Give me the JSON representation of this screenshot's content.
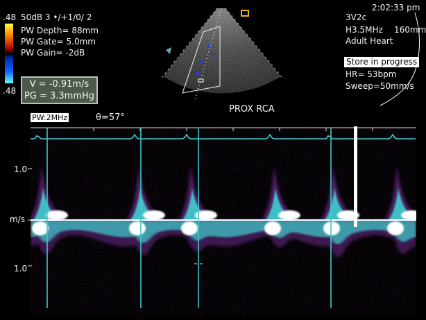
{
  "header": {
    "time": "2:02:33 pm",
    "probe": "3V2c",
    "frequency": "H3.5MHz",
    "depth_mm": "160mm",
    "preset": "Adult Heart",
    "store_status": "Store in progress",
    "heart_rate": "HR= 53bpm",
    "sweep": "Sweep=50mm/s"
  },
  "settings": {
    "top_scale": ".48",
    "bottom_scale": ".48",
    "gain_line": "50dB  3 •/+1/0/ 2",
    "pw_depth": "PW Depth= 88mm",
    "pw_gate": "PW Gate= 5.0mm",
    "pw_gain": "PW Gain= -2dB"
  },
  "measurements": {
    "velocity": "V = -0.91m/s",
    "pressure_gradient": "PG = 3.3mmHg"
  },
  "doppler": {
    "mode_label": "PW:2MHz",
    "angle": "θ=57°",
    "vessel_label": "PROX RCA",
    "y_top_label": "1.0",
    "y_unit_label": "m/s",
    "y_bottom_label": "1.0"
  },
  "colors": {
    "spectrum_core": "#ffffff",
    "spectrum_mid": "#40d0d0",
    "spectrum_low": "#6a2a8a",
    "ecg": "#40c8c8",
    "baseline": "#ffffff",
    "marker": "#f0b020"
  }
}
